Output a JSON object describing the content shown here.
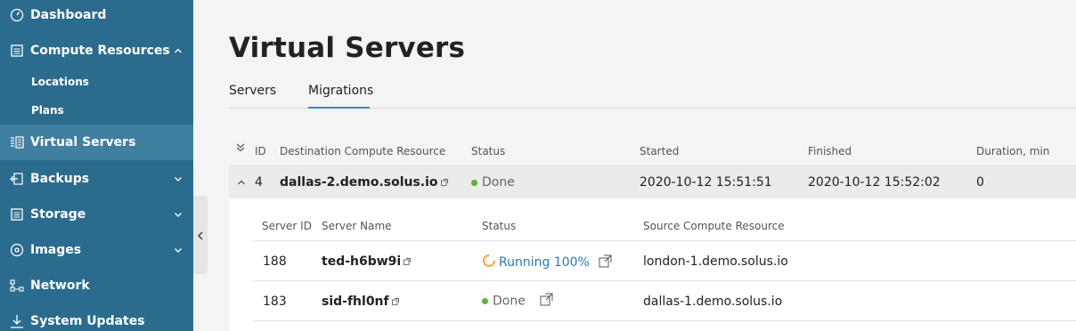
{
  "sidebar": {
    "items": [
      {
        "label": "Dashboard",
        "icon": "gauge-icon"
      },
      {
        "label": "Compute Resources",
        "icon": "server-list-icon",
        "expanded": true
      },
      {
        "label": "Virtual Servers",
        "icon": "virtual-servers-icon",
        "active": true
      },
      {
        "label": "Backups",
        "icon": "backup-icon"
      },
      {
        "label": "Storage",
        "icon": "storage-icon"
      },
      {
        "label": "Images",
        "icon": "disc-icon"
      },
      {
        "label": "Network",
        "icon": "network-icon"
      },
      {
        "label": "System Updates",
        "icon": "download-icon"
      }
    ],
    "subitems": [
      {
        "label": "Locations"
      },
      {
        "label": "Plans"
      }
    ]
  },
  "page": {
    "title": "Virtual Servers",
    "tabs": [
      {
        "label": "Servers",
        "active": false
      },
      {
        "label": "Migrations",
        "active": true
      }
    ]
  },
  "table": {
    "headers": {
      "id": "ID",
      "destination": "Destination Compute Resource",
      "status": "Status",
      "started": "Started",
      "finished": "Finished",
      "duration": "Duration, min"
    },
    "row": {
      "id": "4",
      "destination": "dallas-2.demo.solus.io",
      "status": "Done",
      "started": "2020-10-12 15:51:51",
      "finished": "2020-10-12 15:52:02",
      "duration": "0"
    },
    "nested": {
      "headers": {
        "server_id": "Server ID",
        "server_name": "Server Name",
        "status": "Status",
        "source": "Source Compute Resource"
      },
      "rows": [
        {
          "server_id": "188",
          "server_name": "ted-h6bw9i",
          "status": "Running 100%",
          "source": "london-1.demo.solus.io"
        },
        {
          "server_id": "183",
          "server_name": "sid-fhl0nf",
          "status": "Done",
          "source": "dallas-1.demo.solus.io"
        }
      ]
    }
  },
  "colors": {
    "sidebar_bg": "#2b6c8e",
    "sidebar_active": "#3f7fa0",
    "accent": "#2b8ec2",
    "done_green": "#5fb035",
    "running_orange": "#f0a030"
  }
}
